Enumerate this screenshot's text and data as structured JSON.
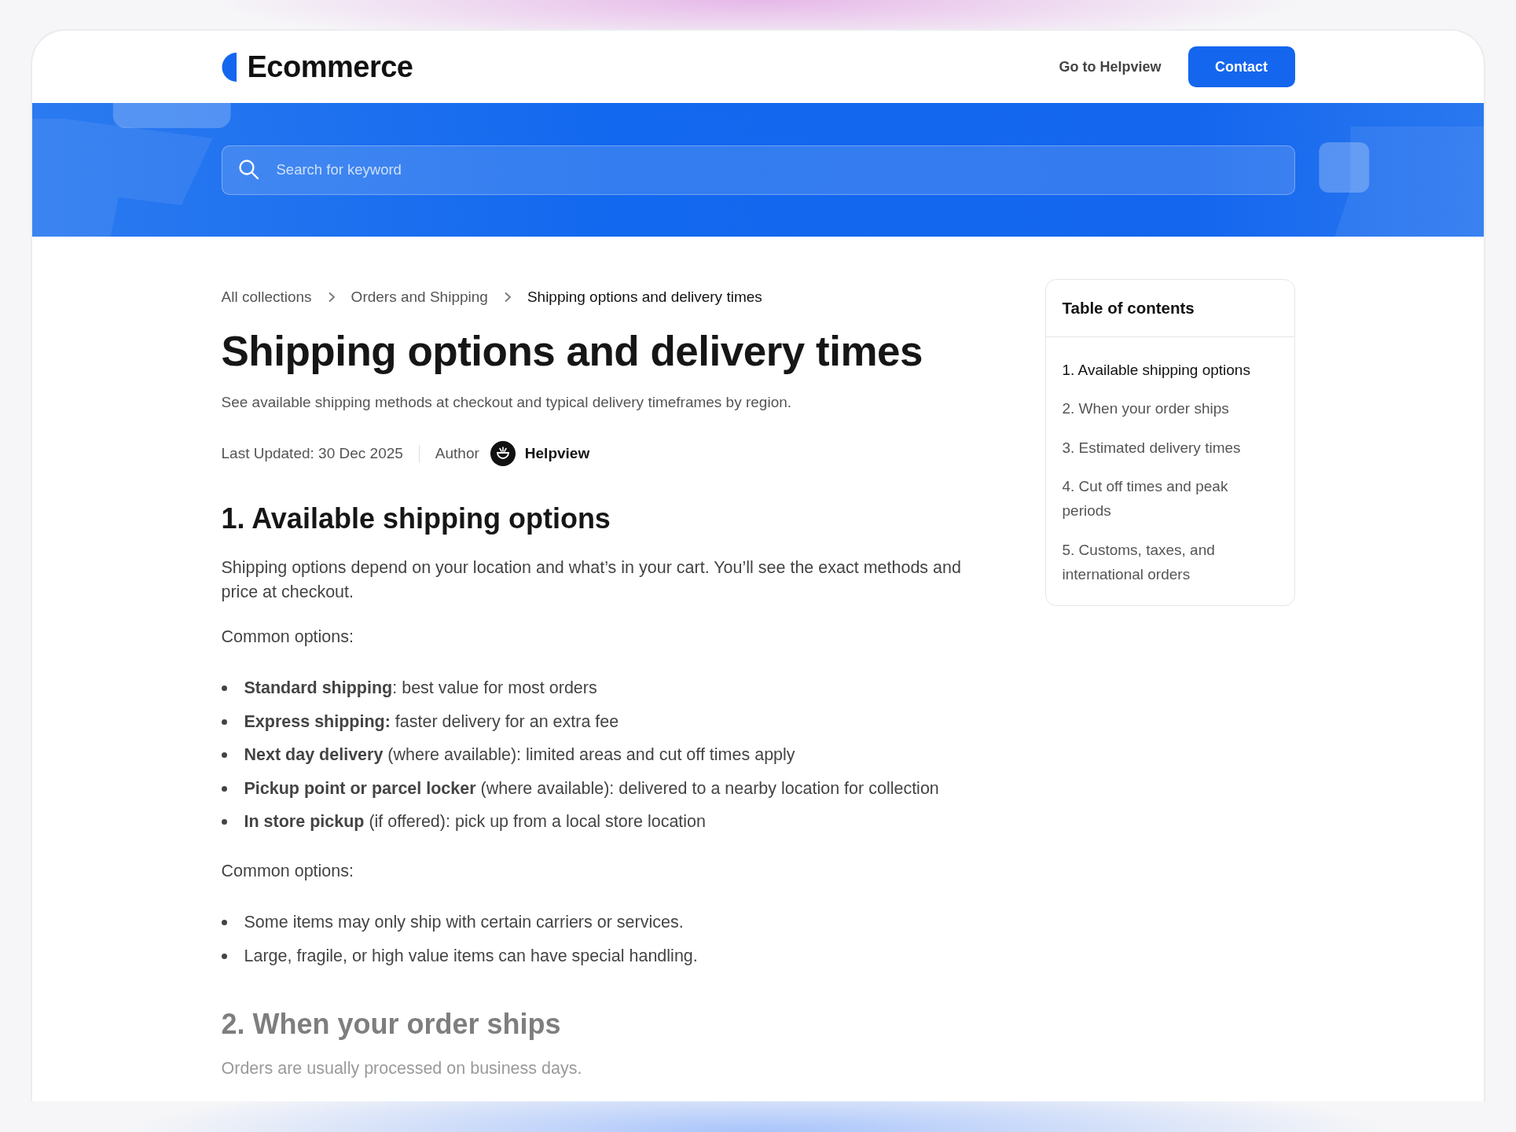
{
  "header": {
    "brand": "Ecommerce",
    "nav_link": "Go to Helpview",
    "contact_button": "Contact"
  },
  "search": {
    "placeholder": "Search for keyword"
  },
  "breadcrumb": [
    {
      "label": "All collections",
      "current": false
    },
    {
      "label": "Orders and Shipping",
      "current": false
    },
    {
      "label": "Shipping options and delivery times",
      "current": true
    }
  ],
  "article": {
    "title": "Shipping options and delivery times",
    "subtitle": "See available shipping methods at checkout and typical delivery timeframes by region.",
    "last_updated": "Last Updated: 30 Dec 2025",
    "author_label": "Author",
    "author_name": "Helpview",
    "sections": [
      {
        "heading": "1. Available shipping options",
        "faded": false,
        "blocks": [
          {
            "kind": "paragraph",
            "text": "Shipping options depend on your location and what’s in your cart. You’ll see the exact methods and price at checkout."
          },
          {
            "kind": "paragraph",
            "text": "Common options:"
          },
          {
            "kind": "list",
            "items": [
              "**Standard shipping**: best value for most orders",
              "**Express shipping:** faster delivery for an extra fee",
              "**Next day delivery** (where available): limited areas and cut off times apply",
              "**Pickup point or parcel locker** (where available): delivered to a nearby location for collection",
              "**In store pickup** (if offered): pick up from a local store location"
            ]
          },
          {
            "kind": "paragraph",
            "text": "Common options:"
          },
          {
            "kind": "list",
            "items": [
              "Some items may only ship with certain carriers or services.",
              "Large, fragile, or high value items can have special handling."
            ]
          }
        ]
      },
      {
        "heading": "2. When your order ships",
        "faded": true,
        "blocks": [
          {
            "kind": "paragraph",
            "text": "Orders are usually processed on business days."
          }
        ]
      }
    ]
  },
  "toc": {
    "title": "Table of contents",
    "items": [
      {
        "label": "1. Available shipping options",
        "selected": true
      },
      {
        "label": "2. When your order ships",
        "selected": false
      },
      {
        "label": "3. Estimated delivery times",
        "selected": false
      },
      {
        "label": "4. Cut off times and peak periods",
        "selected": false
      },
      {
        "label": "5. Customs, taxes, and international orders",
        "selected": false
      }
    ]
  }
}
